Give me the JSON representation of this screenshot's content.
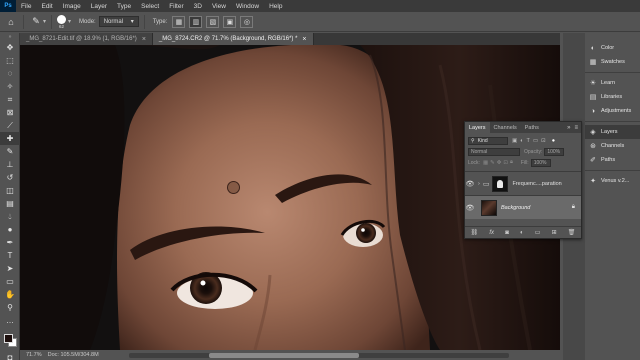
{
  "menu": {
    "app_logo": "Ps",
    "items": [
      "File",
      "Edit",
      "Image",
      "Layer",
      "Type",
      "Select",
      "Filter",
      "3D",
      "View",
      "Window",
      "Help"
    ]
  },
  "options": {
    "brush_size": "62",
    "mode_label": "Mode:",
    "mode_value": "Normal",
    "type_label": "Type:"
  },
  "tabs": [
    {
      "label": "_MG_8721-Edit.tif @ 18.9% (1, RGB/16*)",
      "close": "×"
    },
    {
      "label": "_MG_8724.CR2 @ 71.7% (Background, RGB/16*) *",
      "close": "×"
    }
  ],
  "status": {
    "zoom": "71.7%",
    "doc": "Doc: 105.5M/304.8M"
  },
  "right_panels": {
    "group1": [
      "Color",
      "Swatches"
    ],
    "group2": [
      "Learn",
      "Libraries",
      "Adjustments"
    ],
    "group3": [
      "Layers",
      "Channels",
      "Paths"
    ],
    "group4": [
      "Venus v.2..."
    ]
  },
  "layers_panel": {
    "tabs": [
      "Layers",
      "Channels",
      "Paths"
    ],
    "filter_kind": "Kind",
    "blend_mode": "Normal",
    "opacity_label": "Opacity:",
    "opacity_value": "100%",
    "lock_label": "Lock:",
    "fill_label": "Fill:",
    "fill_value": "100%",
    "layers": [
      {
        "name": "Frequenc....paration",
        "type": "group"
      },
      {
        "name": "Background",
        "type": "image"
      }
    ],
    "footer_icons": [
      "link-icon",
      "fx-icon",
      "mask-icon",
      "adjustment-icon",
      "folder-icon",
      "new-layer-icon",
      "trash-icon"
    ]
  },
  "colors": {
    "foreground": "#1c0e0c",
    "background": "#ffffff",
    "accent": "#31a8ff"
  }
}
